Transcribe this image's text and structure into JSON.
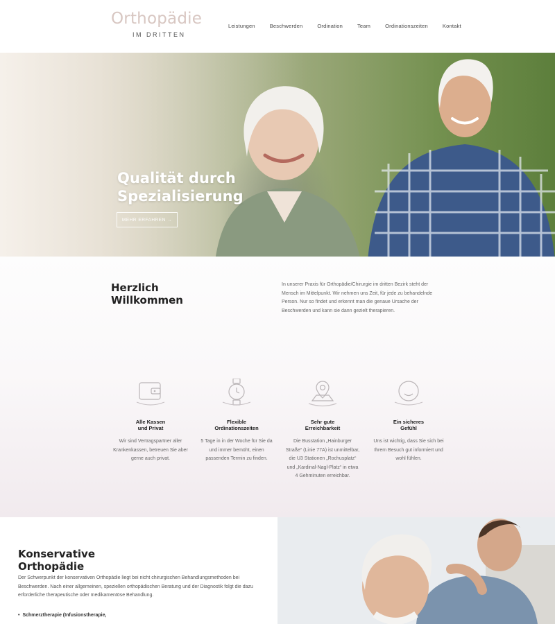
{
  "brand": {
    "name": "Orthopädie",
    "tagline": "IM DRITTEN"
  },
  "nav": [
    "Leistungen",
    "Beschwerden",
    "Ordination",
    "Team",
    "Ordinationszeiten",
    "Kontakt"
  ],
  "hero": {
    "title": "Qualität durch\nSpezialisierung",
    "button": "MEHR ERFAHREN →"
  },
  "welcome": {
    "title": "Herzlich\nWillkommen",
    "text": "In unserer Praxis für Orthopädie/Chirurgie im dritten Bezirk steht der Mensch im Mittelpunkt. Wir nehmen uns Zeit, für jede zu behandelnde Person. Nur so findet und erkennt man die genaue Ursache der Beschwerden und kann sie dann gezielt therapieren."
  },
  "features": [
    {
      "icon": "wallet-icon",
      "title": "Alle Kassen\nund Privat",
      "text": "Wir sind Vertragspartner aller Krankenkassen, betreuen Sie aber gerne auch privat."
    },
    {
      "icon": "watch-icon",
      "title": "Flexible\nOrdinationszeiten",
      "text": "5 Tage in in der Woche für Sie da und immer bemüht, einen passenden Termin zu finden."
    },
    {
      "icon": "map-pin-icon",
      "title": "Sehr gute\nErreichbarkeit",
      "text": "Die Busstation „Hainburger Straße“ (Linie 77A) ist unmittelbar, die U3 Stationen „Rochusplatz“ und „Kardinal-Nagl-Platz“ in etwa 4 Gehminuten erreichbar."
    },
    {
      "icon": "smile-icon",
      "title": "Ein sicheres\nGefühl",
      "text": "Uns ist wichtig, dass Sie sich bei Ihrem Besuch gut informiert und wohl fühlen."
    }
  ],
  "konservativ": {
    "title": "Konservative\nOrthopädie",
    "text": "Der Schwerpunkt der konservativen Orthopädie liegt bei nicht chirurgischen Behandlungsmethoden bei Beschwerden. Nach einer allgemeinen, speziellen orthopädischen Beratung und der Diagnostik folgt die dazu erforderliche therapeutische oder medikamentöse Behandlung.",
    "list": [
      "Schmerztherapie (Infusionstherapie,"
    ]
  },
  "colors": {
    "logo": "#d8c7c2",
    "accent_bg": "#f1eaee"
  }
}
